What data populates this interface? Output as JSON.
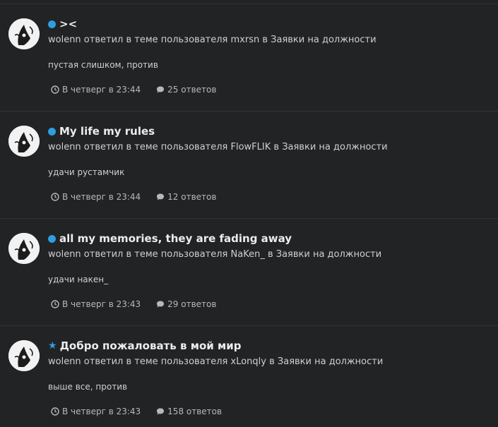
{
  "activities": [
    {
      "marker": "dot",
      "title": "><",
      "summary": "wolenn ответил в теме пользователя mxrsn в Заявки на должности",
      "snippet": "пустая слишком, против",
      "time": "В четверг в 23:44",
      "replies": "25 ответов"
    },
    {
      "marker": "dot",
      "title": "My life my rules",
      "summary": "wolenn ответил в теме пользователя FlowFLIK в Заявки на должности",
      "snippet": "удачи рустамчик",
      "time": "В четверг в 23:44",
      "replies": "12 ответов"
    },
    {
      "marker": "dot",
      "title": "all my memories, they are fading away",
      "summary": "wolenn ответил в теме пользователя NaKen_ в Заявки на должности",
      "snippet": "удачи накен_",
      "time": "В четверг в 23:43",
      "replies": "29 ответов"
    },
    {
      "marker": "star",
      "title": "Добро пожаловать в мой мир",
      "summary": "wolenn ответил в теме пользователя xLonqly в Заявки на должности",
      "snippet": "выше все, против",
      "time": "В четверг в 23:43",
      "replies": "158 ответов"
    }
  ],
  "icons": {
    "time": "clock-icon",
    "replies": "comment-icon",
    "unread": "unread-dot-icon",
    "featured": "star-icon"
  },
  "colors": {
    "background": "#222325",
    "accent": "#2d9ee0",
    "title": "#ececec",
    "text": "#cfcfcf",
    "meta": "#b8b8b8",
    "divider": "#323335"
  }
}
